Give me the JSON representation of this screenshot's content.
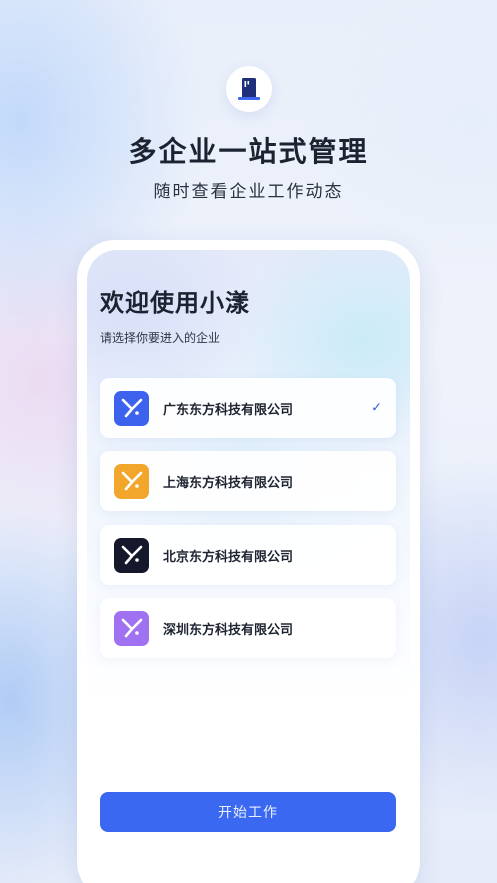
{
  "header": {
    "title": "多企业一站式管理",
    "subtitle": "随时查看企业工作动态",
    "logo_icon": "building-icon"
  },
  "screen": {
    "welcome": "欢迎使用小漾",
    "hint": "请选择你要进入的企业",
    "companies": [
      {
        "name": "广东东方科技有限公司",
        "color": "#3d63ee",
        "selected": true
      },
      {
        "name": "上海东方科技有限公司",
        "color": "#f2a72c",
        "selected": false
      },
      {
        "name": "北京东方科技有限公司",
        "color": "#15172a",
        "selected": false
      },
      {
        "name": "深圳东方科技有限公司",
        "color": "#a071f0",
        "selected": false
      }
    ],
    "check_mark": "✓",
    "start_button": "开始工作"
  },
  "colors": {
    "accent": "#3b68f0",
    "title_text": "#1b2230"
  }
}
